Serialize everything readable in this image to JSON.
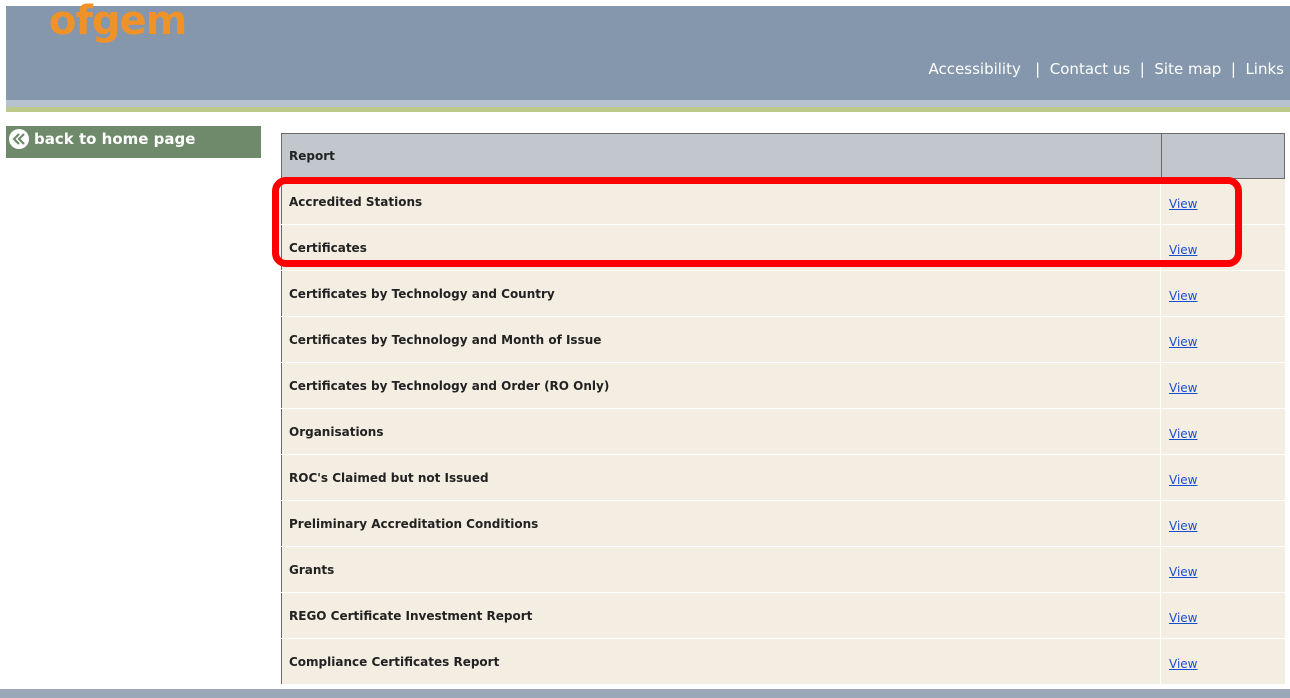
{
  "header": {
    "logo_text": "ofgem",
    "links": [
      "Accessibility",
      "Contact us",
      "Site map",
      "Links"
    ]
  },
  "sidebar": {
    "back_label": "back to home page"
  },
  "table": {
    "col_report": "Report",
    "col_action": "",
    "rows": [
      {
        "name": "Accredited Stations",
        "action": "View"
      },
      {
        "name": "Certificates",
        "action": "View"
      },
      {
        "name": "Certificates by Technology and Country",
        "action": "View"
      },
      {
        "name": "Certificates by Technology and Month of Issue",
        "action": "View"
      },
      {
        "name": "Certificates by Technology and Order (RO Only)",
        "action": "View"
      },
      {
        "name": "Organisations",
        "action": "View"
      },
      {
        "name": "ROC's Claimed but not Issued",
        "action": "View"
      },
      {
        "name": "Preliminary Accreditation Conditions",
        "action": "View"
      },
      {
        "name": "Grants",
        "action": "View"
      },
      {
        "name": "REGO Certificate Investment Report",
        "action": "View"
      },
      {
        "name": "Compliance Certificates Report",
        "action": "View"
      }
    ]
  },
  "colors": {
    "header_bg": "#8497ac",
    "logo": "#f0922a",
    "back_button": "#6f8a6a",
    "row_bg": "#f4ede2",
    "link": "#1a4ed1",
    "highlight": "#ff0000"
  }
}
